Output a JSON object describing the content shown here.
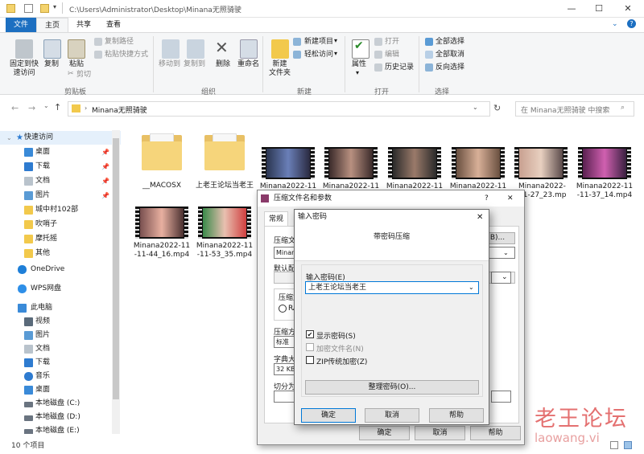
{
  "window": {
    "path": "C:\\Users\\Administrator\\Desktop\\Minana无照骑驶",
    "minimize": "—",
    "maximize": "☐",
    "close": "✕"
  },
  "tabs": {
    "file": "文件",
    "home": "主页",
    "share": "共享",
    "view": "查看",
    "help": "?"
  },
  "ribbon": {
    "pin": "固定到快\n速访问",
    "copy": "复制",
    "paste": "粘贴",
    "copy_path": "复制路径",
    "paste_shortcut": "粘贴快捷方式",
    "cut": "剪切",
    "group_clipboard": "剪贴板",
    "move_to": "移动到",
    "copy_to": "复制到",
    "delete": "删除",
    "rename": "重命名",
    "group_organize": "组织",
    "new_folder": "新建\n文件夹",
    "new_item": "新建项目",
    "easy_access": "轻松访问",
    "group_new": "新建",
    "properties": "属性",
    "open": "打开",
    "edit": "编辑",
    "history": "历史记录",
    "group_open": "打开",
    "select_all": "全部选择",
    "select_none": "全部取消",
    "invert": "反向选择",
    "group_select": "选择"
  },
  "address": {
    "folder": "Minana无照骑驶",
    "search_placeholder": "在 Minana无照骑驶 中搜索"
  },
  "nav": {
    "quick_access": "快速访问",
    "items": [
      "桌面",
      "下载",
      "文档",
      "图片",
      "城中村102部",
      "吹哨子",
      "摩托摇",
      "其他"
    ],
    "onedrive": "OneDrive",
    "wps": "WPS网盘",
    "this_pc": "此电脑",
    "pc_items": [
      "视频",
      "图片",
      "文档",
      "下载",
      "音乐",
      "桌面",
      "本地磁盘 (C:)",
      "本地磁盘 (D:)",
      "本地磁盘 (E:)"
    ]
  },
  "files": [
    {
      "name": "__MACOSX",
      "type": "folder"
    },
    {
      "name": "上老王论坛当老王",
      "type": "folder"
    },
    {
      "name": "Minana2022-11",
      "type": "video"
    },
    {
      "name": "Minana2022-11",
      "type": "video"
    },
    {
      "name": "Minana2022-11",
      "type": "video"
    },
    {
      "name": "Minana2022-11",
      "type": "video"
    },
    {
      "name": "Minana2022-11-27_23.mp4",
      "type": "video"
    },
    {
      "name": "Minana2022-11-11-37_14.mp4",
      "type": "video"
    },
    {
      "name": "Minana2022-11-11-44_16.mp4",
      "type": "video"
    },
    {
      "name": "Minana2022-11-11-53_35.mp4",
      "type": "video"
    }
  ],
  "status": {
    "count": "10 个项目"
  },
  "archive_dialog": {
    "title": "压缩文件名和参数",
    "help": "?",
    "close": "✕",
    "tab_general": "常规",
    "label_archive": "压缩文",
    "archive_value": "Minana",
    "label_profile": "默认配",
    "label_format": "压缩文",
    "format_option": "RA",
    "label_method": "压缩方",
    "method_value": "标准",
    "label_dict": "字典大",
    "dict_value": "32 KB",
    "label_split": "切分为",
    "browse": "B)...",
    "ok": "确定",
    "cancel": "取消",
    "help_btn": "帮助"
  },
  "password_dialog": {
    "title": "输入密码",
    "close": "✕",
    "header": "带密码压缩",
    "label": "输入密码(E)",
    "value": "上老王论坛当老王",
    "show_password": "显示密码(S)",
    "encrypt_names": "加密文件名(N)",
    "zip_legacy": "ZIP传统加密(Z)",
    "organize": "整理密码(O)...",
    "ok": "确定",
    "cancel": "取消",
    "help": "帮助"
  },
  "watermark": {
    "cn": "老王论坛",
    "url": "laowang.vi"
  }
}
